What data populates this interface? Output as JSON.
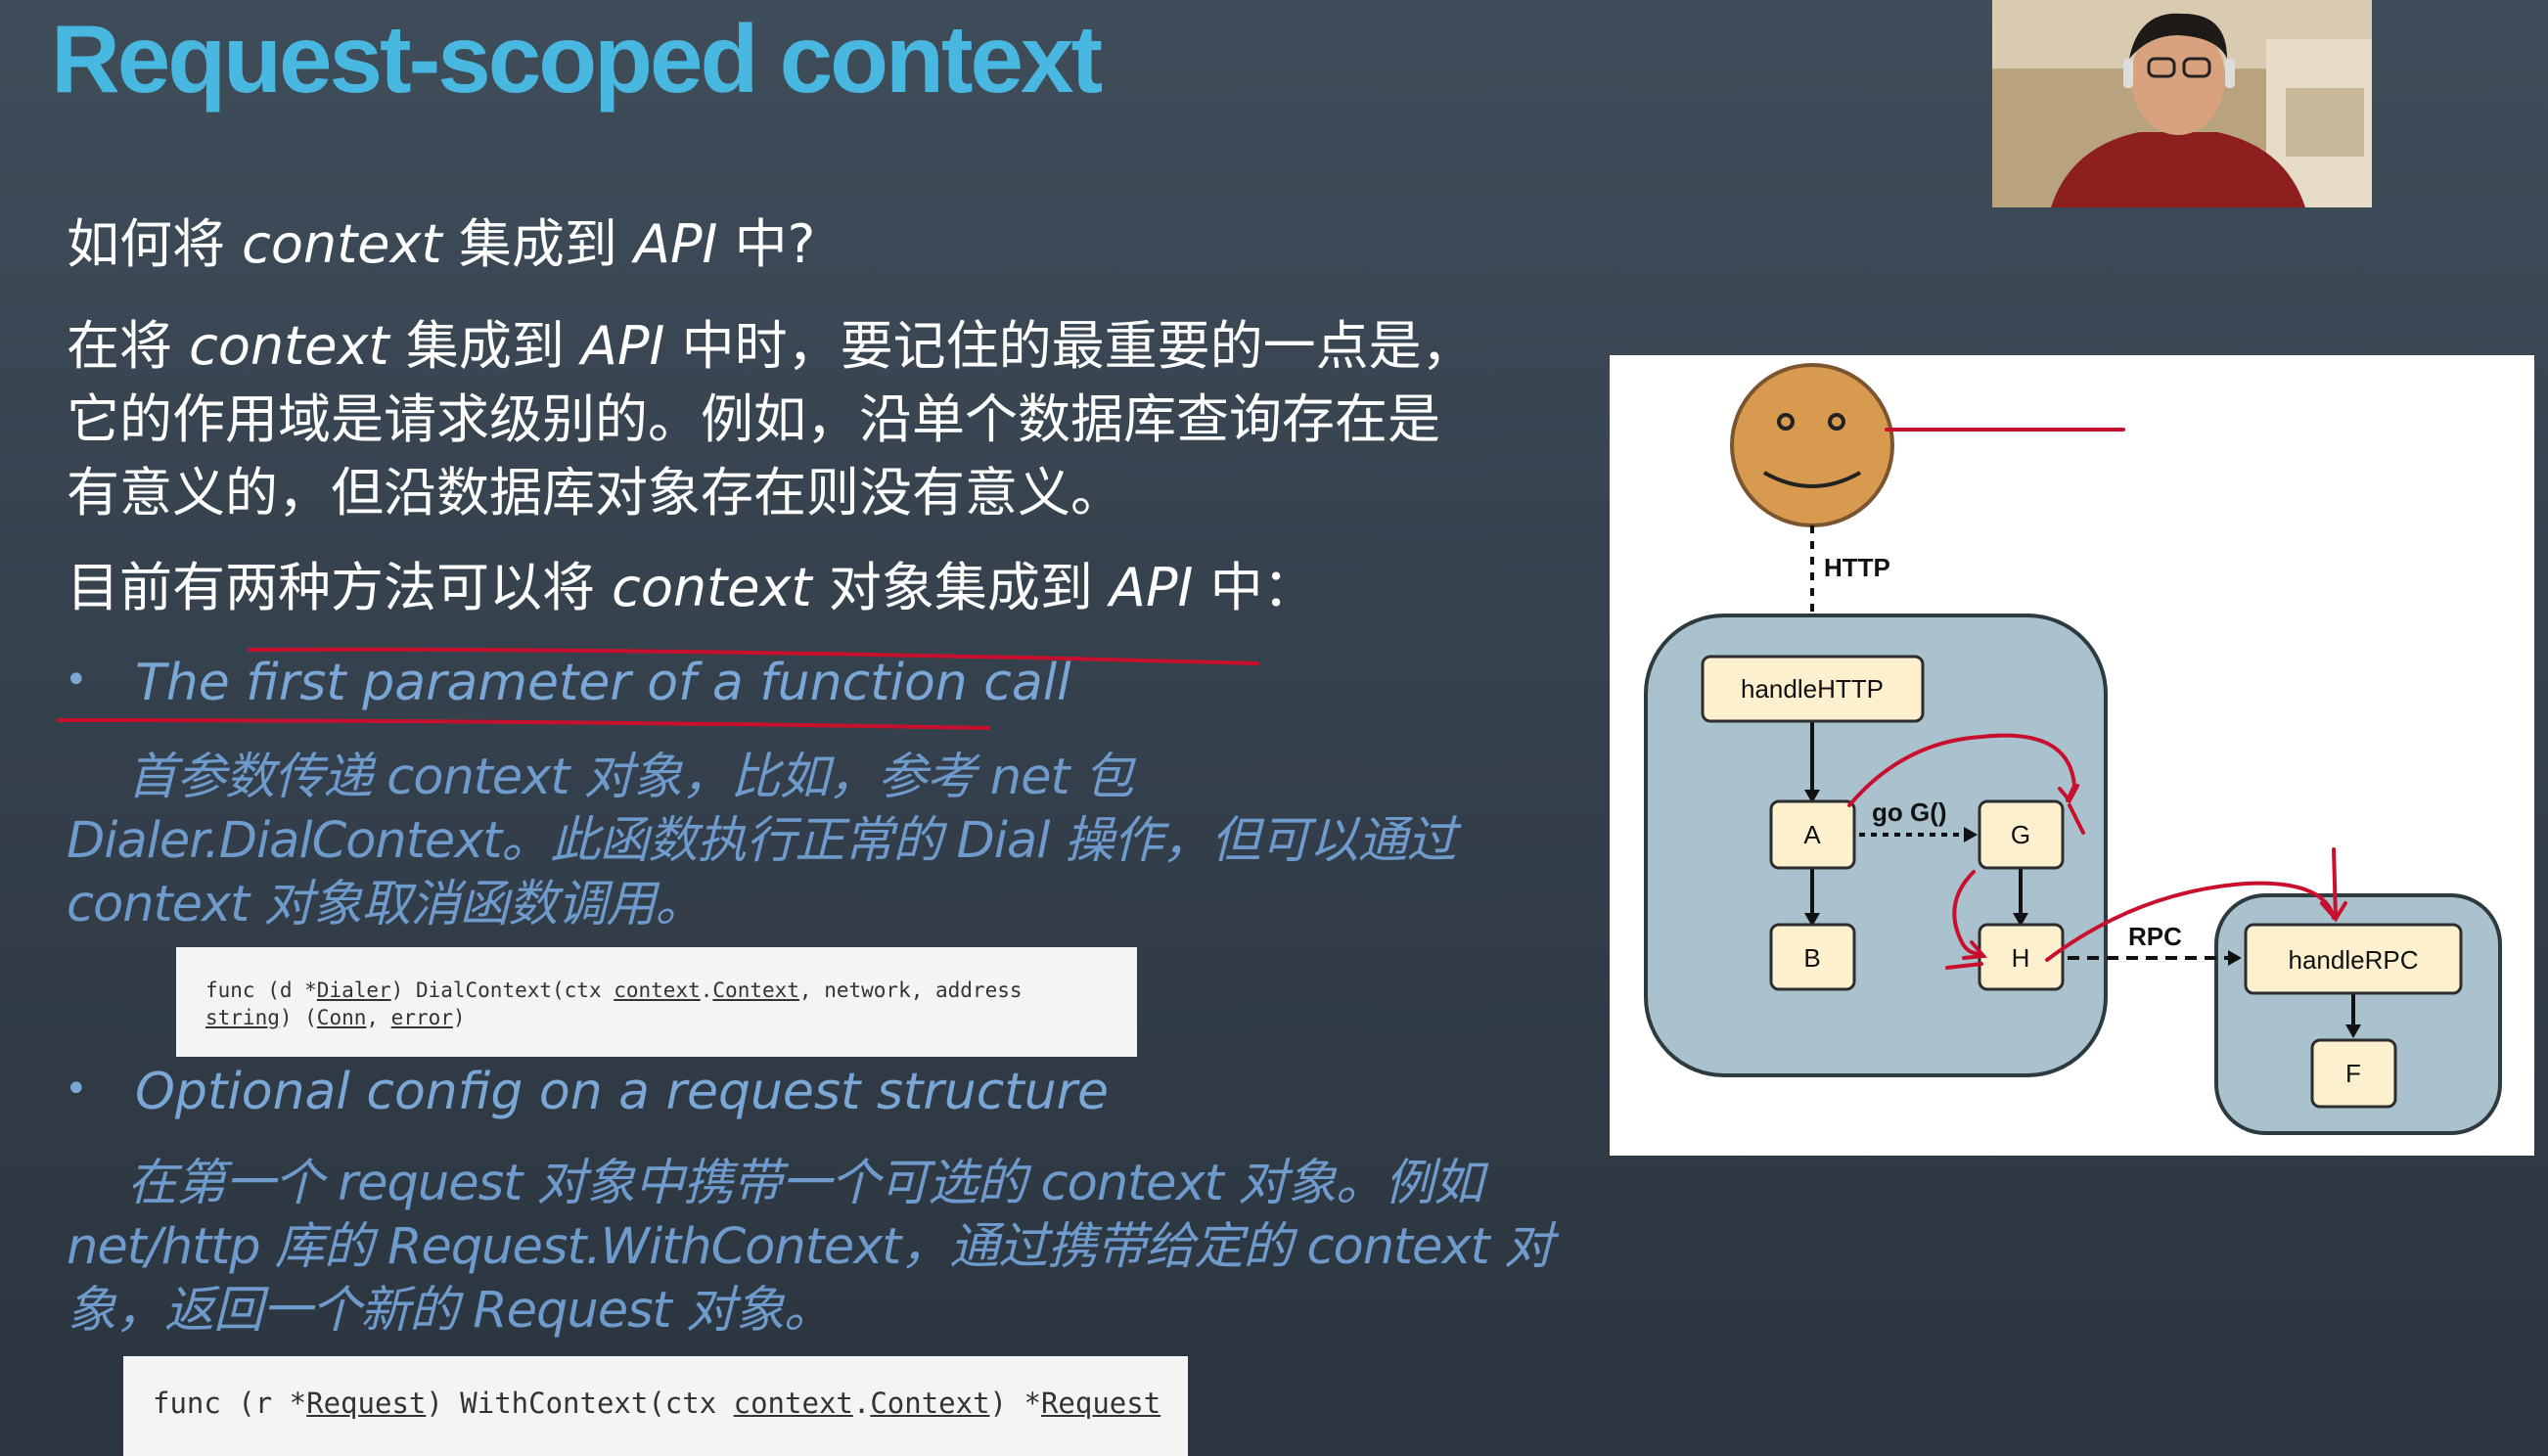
{
  "slide": {
    "title": "Request-scoped context"
  },
  "question": {
    "pre": "如何将 ",
    "it1": "context",
    "mid": " 集成到 ",
    "it2": "API",
    "post": " 中?"
  },
  "answer": {
    "line1_pre": "在将 ",
    "line1_it1": "context",
    "line1_mid": " 集成到 ",
    "line1_it2": "API",
    "line1_post": " 中时，要记住的最重要的一点是，",
    "line2": "它的作用域是请求级别的。例如，沿单个数据库查询存在是",
    "line3": "有意义的，但沿数据库对象存在则没有意义。"
  },
  "methods": {
    "pre": "目前有两种方法可以将 ",
    "it1": "context",
    "mid": " 对象集成到 ",
    "it2": "API",
    "post": " 中："
  },
  "bullets": [
    {
      "title": "The first parameter of a function call",
      "desc": [
        "首参数传递 context 对象，比如，参考  net 包",
        "Dialer.DialContext。此函数执行正常的 Dial 操作，但可以通过",
        "context 对象取消函数调用。"
      ],
      "code": {
        "line1": {
          "p1": "func (d *",
          "l1": "Dialer",
          "p2": ") DialContext(ctx ",
          "l2": "context",
          "p3": ".",
          "l3": "Context",
          "p4": ", network, address"
        },
        "line2": {
          "l1": "string",
          "p1": ") (",
          "l2": "Conn",
          "p2": ", ",
          "l3": "error",
          "p3": ")"
        }
      }
    },
    {
      "title": "Optional config on a request structure",
      "desc": [
        "在第一个 request 对象中携带一个可选的 context 对象。例如",
        "net/http 库的 Request.WithContext，通过携带给定的 context 对",
        "象，返回一个新的 Request 对象。"
      ],
      "code": {
        "line1": {
          "p1": "func (r *",
          "l1": "Request",
          "p2": ") WithContext(ctx ",
          "l2": "context",
          "p3": ".",
          "l3": "Context",
          "p4": ") *",
          "l4": "Request"
        }
      }
    }
  ],
  "diagram": {
    "http_label": "HTTP",
    "handle_http": "handleHTTP",
    "node_a": "A",
    "node_b": "B",
    "node_g": "G",
    "node_h": "H",
    "go_label": "go G()",
    "rpc_label": "RPC",
    "handle_rpc": "handleRPC",
    "node_f": "F"
  },
  "colors": {
    "title": "#48b8e0",
    "bullet": "#7ba7d6",
    "italic_text": "#6f9acc",
    "annotation": "#c8102e",
    "node_fill": "#fcf0cf",
    "box_fill": "#a9c2cd",
    "smiley": "#d89a4e"
  }
}
